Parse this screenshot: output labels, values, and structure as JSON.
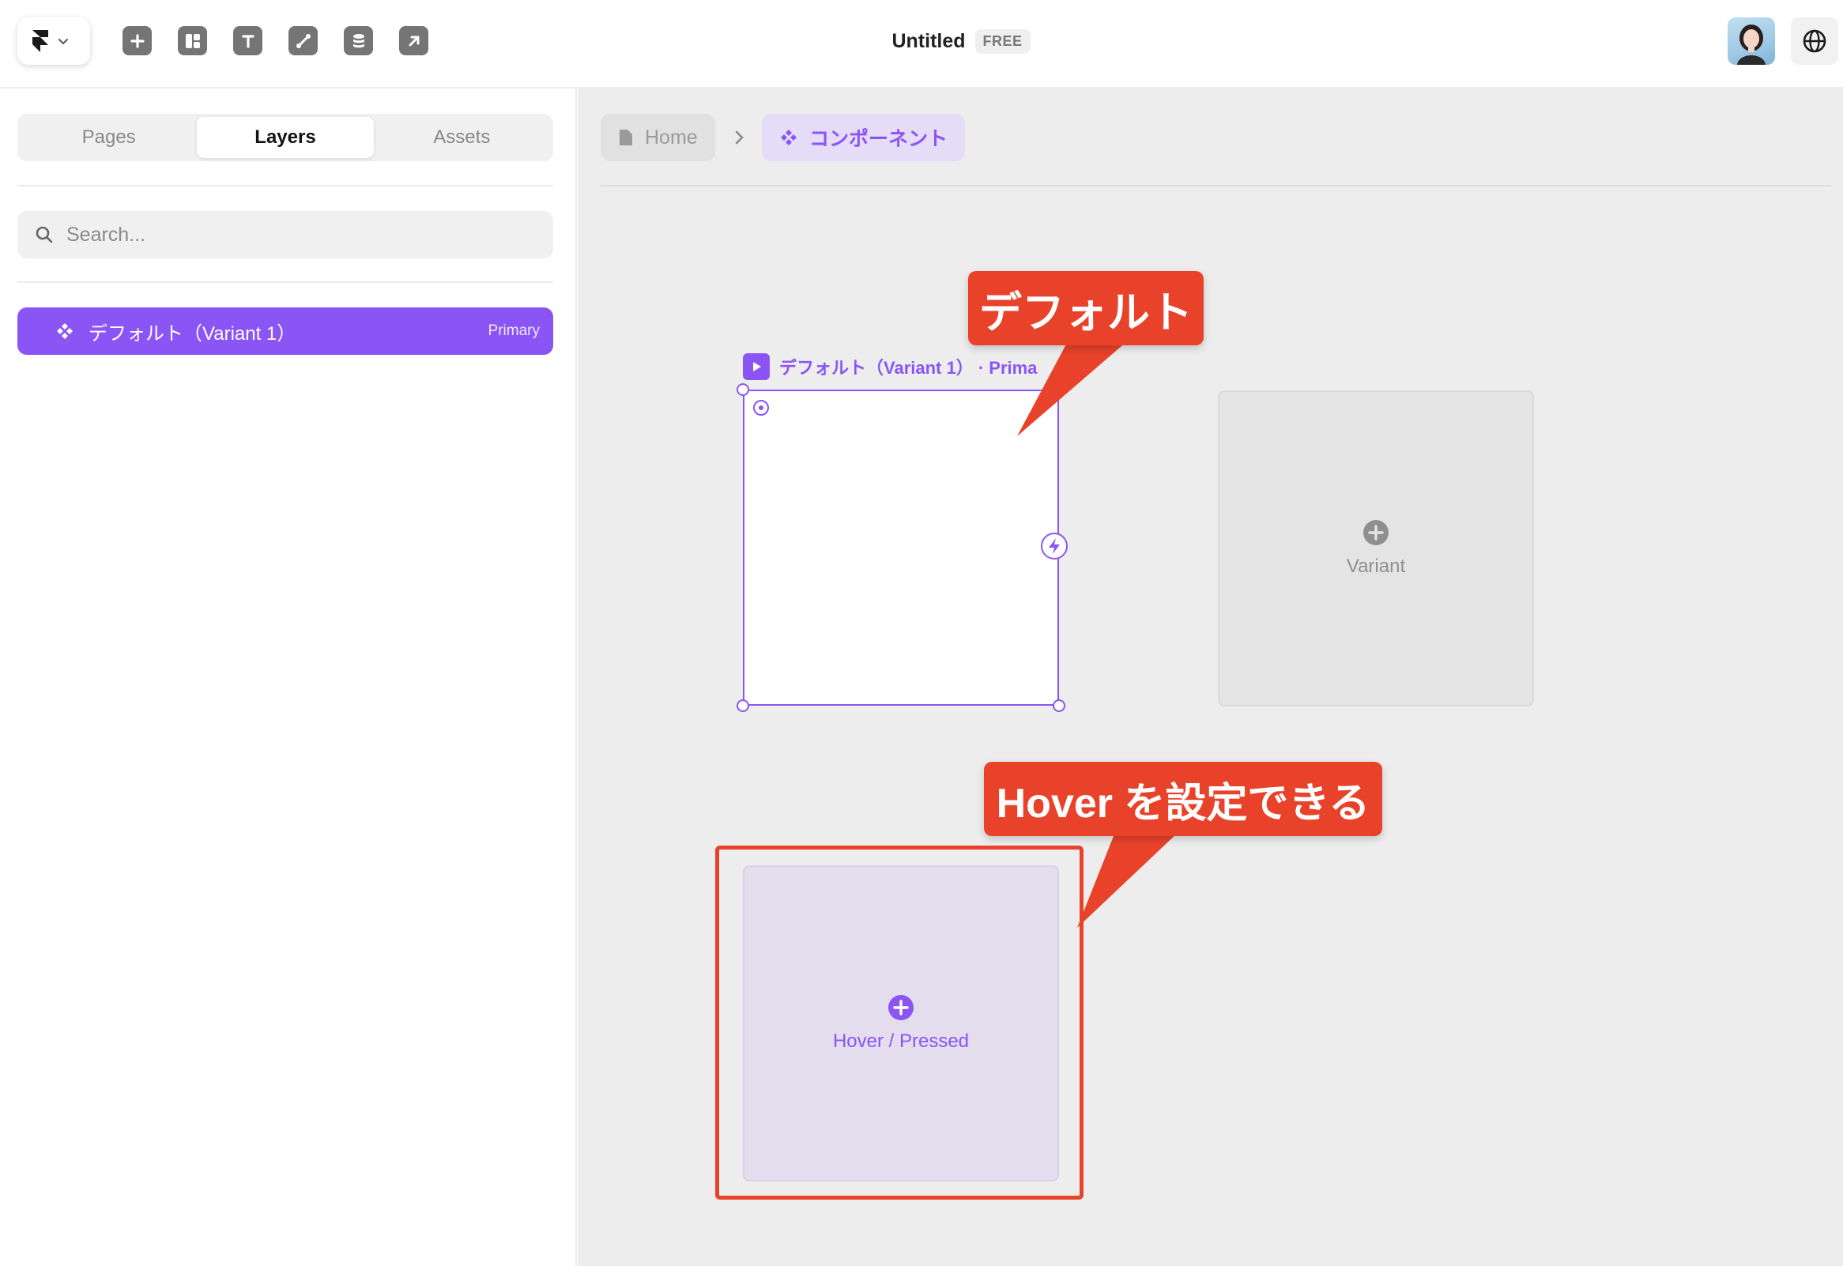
{
  "app": {
    "title": "Untitled",
    "plan_badge": "FREE"
  },
  "toolbar": {
    "tools": [
      {
        "icon": "plus-icon"
      },
      {
        "icon": "layout-icon"
      },
      {
        "icon": "text-icon"
      },
      {
        "icon": "vector-icon"
      },
      {
        "icon": "cms-database-icon"
      },
      {
        "icon": "arrow-up-right-icon"
      }
    ]
  },
  "sidebar": {
    "tabs": [
      {
        "label": "Pages",
        "active": false
      },
      {
        "label": "Layers",
        "active": true
      },
      {
        "label": "Assets",
        "active": false
      }
    ],
    "search": {
      "placeholder": "Search...",
      "value": ""
    },
    "layers": [
      {
        "label": "デフォルト（Variant 1）",
        "tag": "Primary",
        "selected": true
      }
    ]
  },
  "breadcrumb": {
    "home": "Home",
    "component": "コンポーネント"
  },
  "canvas": {
    "frame_label": "デフォルト（Variant 1） · Prima",
    "variant_label": "Variant",
    "hover_label": "Hover / Pressed"
  },
  "annotations": {
    "callout_default": "デフォルト",
    "callout_hover": "Hover を設定できる"
  },
  "colors": {
    "accent": "#8b55f6",
    "callout": "#e8422a",
    "canvas_bg": "#ededed"
  }
}
